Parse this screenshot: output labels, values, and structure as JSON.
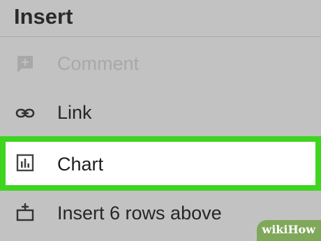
{
  "header": {
    "title": "Insert"
  },
  "menu": {
    "items": [
      {
        "label": "Comment",
        "icon": "comment-add-icon",
        "disabled": true
      },
      {
        "label": "Link",
        "icon": "link-icon"
      },
      {
        "label": "Chart",
        "icon": "chart-icon",
        "highlighted": true
      },
      {
        "label": "Insert 6 rows above",
        "icon": "insert-rows-above-icon"
      }
    ]
  },
  "watermark": {
    "text": "wikiHow"
  },
  "colors": {
    "highlight_border": "#3ed51f",
    "background": "#c2c2c2"
  }
}
